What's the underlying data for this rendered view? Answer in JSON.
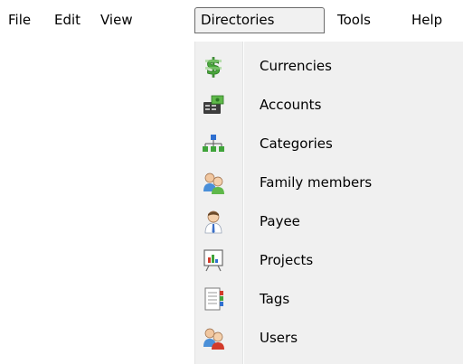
{
  "menubar": {
    "file": "File",
    "edit": "Edit",
    "view": "View",
    "directories": "Directories",
    "tools": "Tools",
    "help": "Help"
  },
  "dropdown": {
    "items": [
      {
        "label": "Currencies",
        "icon": "currency-icon"
      },
      {
        "label": "Accounts",
        "icon": "accounts-icon"
      },
      {
        "label": "Categories",
        "icon": "categories-icon"
      },
      {
        "label": "Family members",
        "icon": "family-members-icon"
      },
      {
        "label": "Payee",
        "icon": "payee-icon"
      },
      {
        "label": "Projects",
        "icon": "projects-icon"
      },
      {
        "label": "Tags",
        "icon": "tags-icon"
      },
      {
        "label": "Users",
        "icon": "users-icon"
      }
    ]
  },
  "colors": {
    "menu_background": "#f0f0f0",
    "active_border": "#6b6b6b"
  }
}
